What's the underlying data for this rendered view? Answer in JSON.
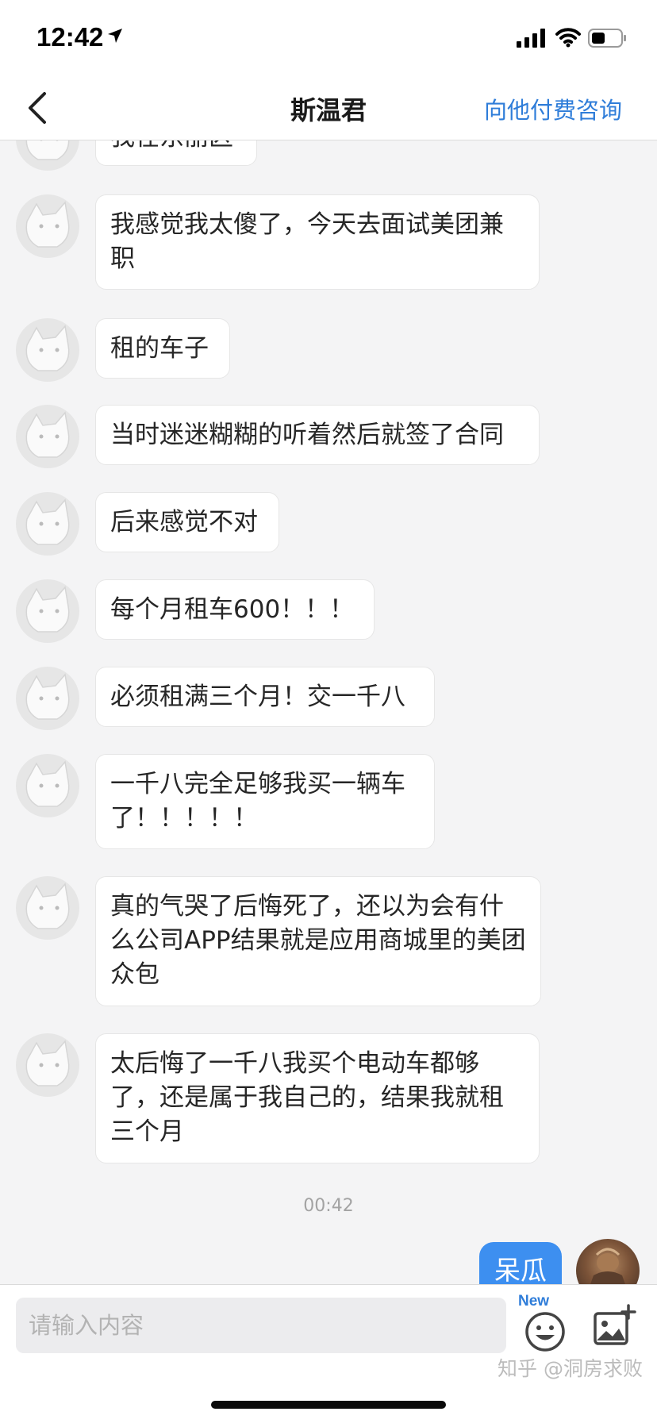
{
  "status_bar": {
    "time": "12:42"
  },
  "header": {
    "title": "斯温君",
    "action_label": "向他付费咨询"
  },
  "messages": [
    {
      "text": "我在东丽区"
    },
    {
      "text": "我感觉我太傻了，今天去面试美团兼职"
    },
    {
      "text": "租的车子"
    },
    {
      "text": "当时迷迷糊糊的听着然后就签了合同"
    },
    {
      "text": "后来感觉不对"
    },
    {
      "text": "每个月租车600！！！"
    },
    {
      "text": "必须租满三个月！交一千八"
    },
    {
      "text": "一千八完全足够我买一辆车了！！！！！"
    },
    {
      "text": "真的气哭了后悔死了，还以为会有什么公司APP结果就是应用商城里的美团众包"
    },
    {
      "text": "太后悔了一千八我买个电动车都够了，还是属于我自己的，结果我就租三个月"
    }
  ],
  "timestamp": "00:42",
  "my_message": {
    "text": "呆瓜"
  },
  "input": {
    "placeholder": "请输入内容",
    "new_badge": "New"
  },
  "watermark": "知乎 @洞房求败",
  "colors": {
    "accent": "#2f7dd9",
    "my_bubble": "#3d8ff0",
    "background": "#f4f4f5"
  }
}
